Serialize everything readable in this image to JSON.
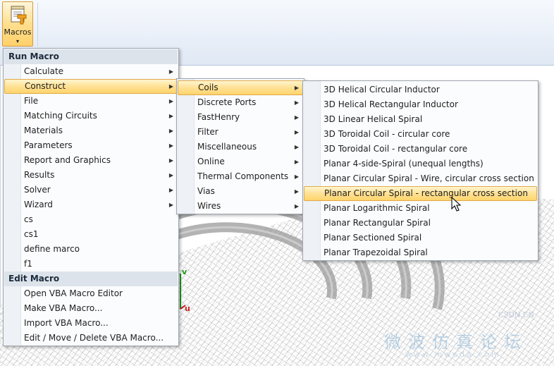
{
  "ribbon": {
    "macros_label": "Macros",
    "macros_icon": "macro-scroll-icon",
    "dropdown_arrow": "▾"
  },
  "axes": {
    "v_label": "v",
    "u_label": "u"
  },
  "main_menu": {
    "run_header": "Run Macro",
    "run_items": [
      {
        "label": "Calculate",
        "submenu": true
      },
      {
        "label": "Construct",
        "submenu": true
      },
      {
        "label": "File",
        "submenu": true
      },
      {
        "label": "Matching Circuits",
        "submenu": true
      },
      {
        "label": "Materials",
        "submenu": true
      },
      {
        "label": "Parameters",
        "submenu": true
      },
      {
        "label": "Report and Graphics",
        "submenu": true
      },
      {
        "label": "Results",
        "submenu": true
      },
      {
        "label": "Solver",
        "submenu": true
      },
      {
        "label": "Wizard",
        "submenu": true
      },
      {
        "label": "cs",
        "submenu": false
      },
      {
        "label": "cs1",
        "submenu": false
      },
      {
        "label": "define marco",
        "submenu": false
      },
      {
        "label": "f1",
        "submenu": false
      }
    ],
    "edit_header": "Edit Macro",
    "edit_items": [
      {
        "label": "Open VBA Macro Editor"
      },
      {
        "label": "Make VBA Macro..."
      },
      {
        "label": "Import VBA Macro..."
      },
      {
        "label": "Edit / Move / Delete VBA Macro..."
      }
    ]
  },
  "construct_menu": {
    "items": [
      {
        "label": "Coils"
      },
      {
        "label": "Discrete Ports"
      },
      {
        "label": "FastHenry"
      },
      {
        "label": "Filter"
      },
      {
        "label": "Miscellaneous"
      },
      {
        "label": "Online"
      },
      {
        "label": "Thermal Components"
      },
      {
        "label": "Vias"
      },
      {
        "label": "Wires"
      }
    ]
  },
  "coils_menu": {
    "items": [
      {
        "label": "3D Helical Circular Inductor"
      },
      {
        "label": "3D Helical Rectangular Inductor"
      },
      {
        "label": "3D Linear Helical Spiral"
      },
      {
        "label": "3D Toroidal Coil - circular core"
      },
      {
        "label": "3D Toroidal Coil - rectangular core"
      },
      {
        "label": "Planar 4-side-Spiral (unequal lengths)"
      },
      {
        "label": "Planar Circular Spiral - Wire, circular cross section"
      },
      {
        "label": "Planar Circular Spiral - rectangular cross section"
      },
      {
        "label": "Planar Logarithmic Spiral"
      },
      {
        "label": "Planar Rectangular Spiral"
      },
      {
        "label": "Planar Sectioned Spiral"
      },
      {
        "label": "Planar Trapezoidal Spiral"
      }
    ]
  },
  "submenu_arrow": "▶",
  "watermark": {
    "tag": "CSDN.CN",
    "cn_text": "微波仿真论坛",
    "url": "www.mweda.com"
  },
  "colors": {
    "highlight_top": "#fff5cf",
    "highlight_bottom": "#ffd46b",
    "highlight_border": "#e0a94a",
    "menu_header": "#dde3ea",
    "axis_v": "#1a9a1a",
    "axis_u": "#c81e1e"
  }
}
